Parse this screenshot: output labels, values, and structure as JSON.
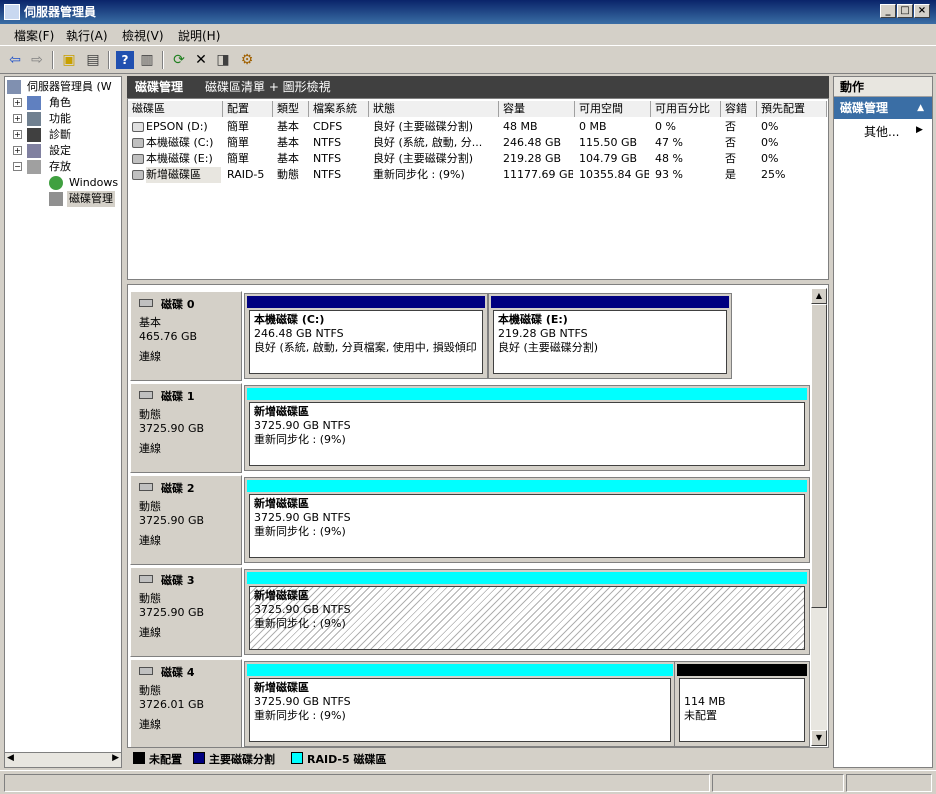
{
  "window": {
    "title": "伺服器管理員"
  },
  "menu": [
    "檔案(F)",
    "執行(A)",
    "檢視(V)",
    "說明(H)"
  ],
  "tree": {
    "root": "伺服器管理員 (W",
    "items": [
      "角色",
      "功能",
      "診斷",
      "設定",
      "存放"
    ],
    "children": [
      "Windows S",
      "磁碟管理"
    ]
  },
  "center": {
    "title": "磁碟管理",
    "subtitle": "磁碟區清單 + 圖形檢視"
  },
  "table": {
    "headers": [
      "磁碟區",
      "配置",
      "類型",
      "檔案系統",
      "狀態",
      "容量",
      "可用空間",
      "可用百分比",
      "容錯",
      "預先配置"
    ],
    "rows": [
      [
        "EPSON (D:)",
        "簡單",
        "基本",
        "CDFS",
        "良好 (主要磁碟分割)",
        "48 MB",
        "0 MB",
        "0 %",
        "否",
        "0%"
      ],
      [
        "本機磁碟 (C:)",
        "簡單",
        "基本",
        "NTFS",
        "良好 (系統, 啟動, 分...",
        "246.48 GB",
        "115.50 GB",
        "47 %",
        "否",
        "0%"
      ],
      [
        "本機磁碟 (E:)",
        "簡單",
        "基本",
        "NTFS",
        "良好 (主要磁碟分割)",
        "219.28 GB",
        "104.79 GB",
        "48 %",
        "否",
        "0%"
      ],
      [
        "新增磁碟區",
        "RAID-5",
        "動態",
        "NTFS",
        "重新同步化 : (9%)",
        "11177.69 GB",
        "10355.84 GB",
        "93 %",
        "是",
        "25%"
      ]
    ]
  },
  "disks": [
    {
      "name": "磁碟 0",
      "type": "基本",
      "size": "465.76 GB",
      "status": "連線",
      "volumes": [
        {
          "name": "本機磁碟  (C:)",
          "fs": "246.48 GB NTFS",
          "status": "良好 (系統, 啟動, 分頁檔案, 使用中, 損毀傾印"
        },
        {
          "name": "本機磁碟  (E:)",
          "fs": "219.28 GB NTFS",
          "status": "良好 (主要磁碟分割)"
        }
      ]
    },
    {
      "name": "磁碟 1",
      "type": "動態",
      "size": "3725.90 GB",
      "status": "連線",
      "volumes": [
        {
          "name": "新增磁碟區",
          "fs": "3725.90 GB NTFS",
          "status": "重新同步化 : (9%)"
        }
      ]
    },
    {
      "name": "磁碟 2",
      "type": "動態",
      "size": "3725.90 GB",
      "status": "連線",
      "volumes": [
        {
          "name": "新增磁碟區",
          "fs": "3725.90 GB NTFS",
          "status": "重新同步化 : (9%)"
        }
      ]
    },
    {
      "name": "磁碟 3",
      "type": "動態",
      "size": "3725.90 GB",
      "status": "連線",
      "volumes": [
        {
          "name": "新增磁碟區",
          "fs": "3725.90 GB NTFS",
          "status": "重新同步化 : (9%)"
        }
      ]
    },
    {
      "name": "磁碟 4",
      "type": "動態",
      "size": "3726.01 GB",
      "status": "連線",
      "volumes": [
        {
          "name": "新增磁碟區",
          "fs": "3725.90 GB NTFS",
          "status": "重新同步化 : (9%)"
        },
        {
          "name": "",
          "fs": "114 MB",
          "status": "未配置"
        }
      ]
    }
  ],
  "legend": [
    "未配置",
    "主要磁碟分割",
    "RAID-5 磁碟區"
  ],
  "colors": {
    "unallocated": "#000000",
    "primary": "#000080",
    "raid5": "#00ffff"
  },
  "actions": {
    "header": "動作",
    "section": "磁碟管理",
    "more": "其他..."
  }
}
